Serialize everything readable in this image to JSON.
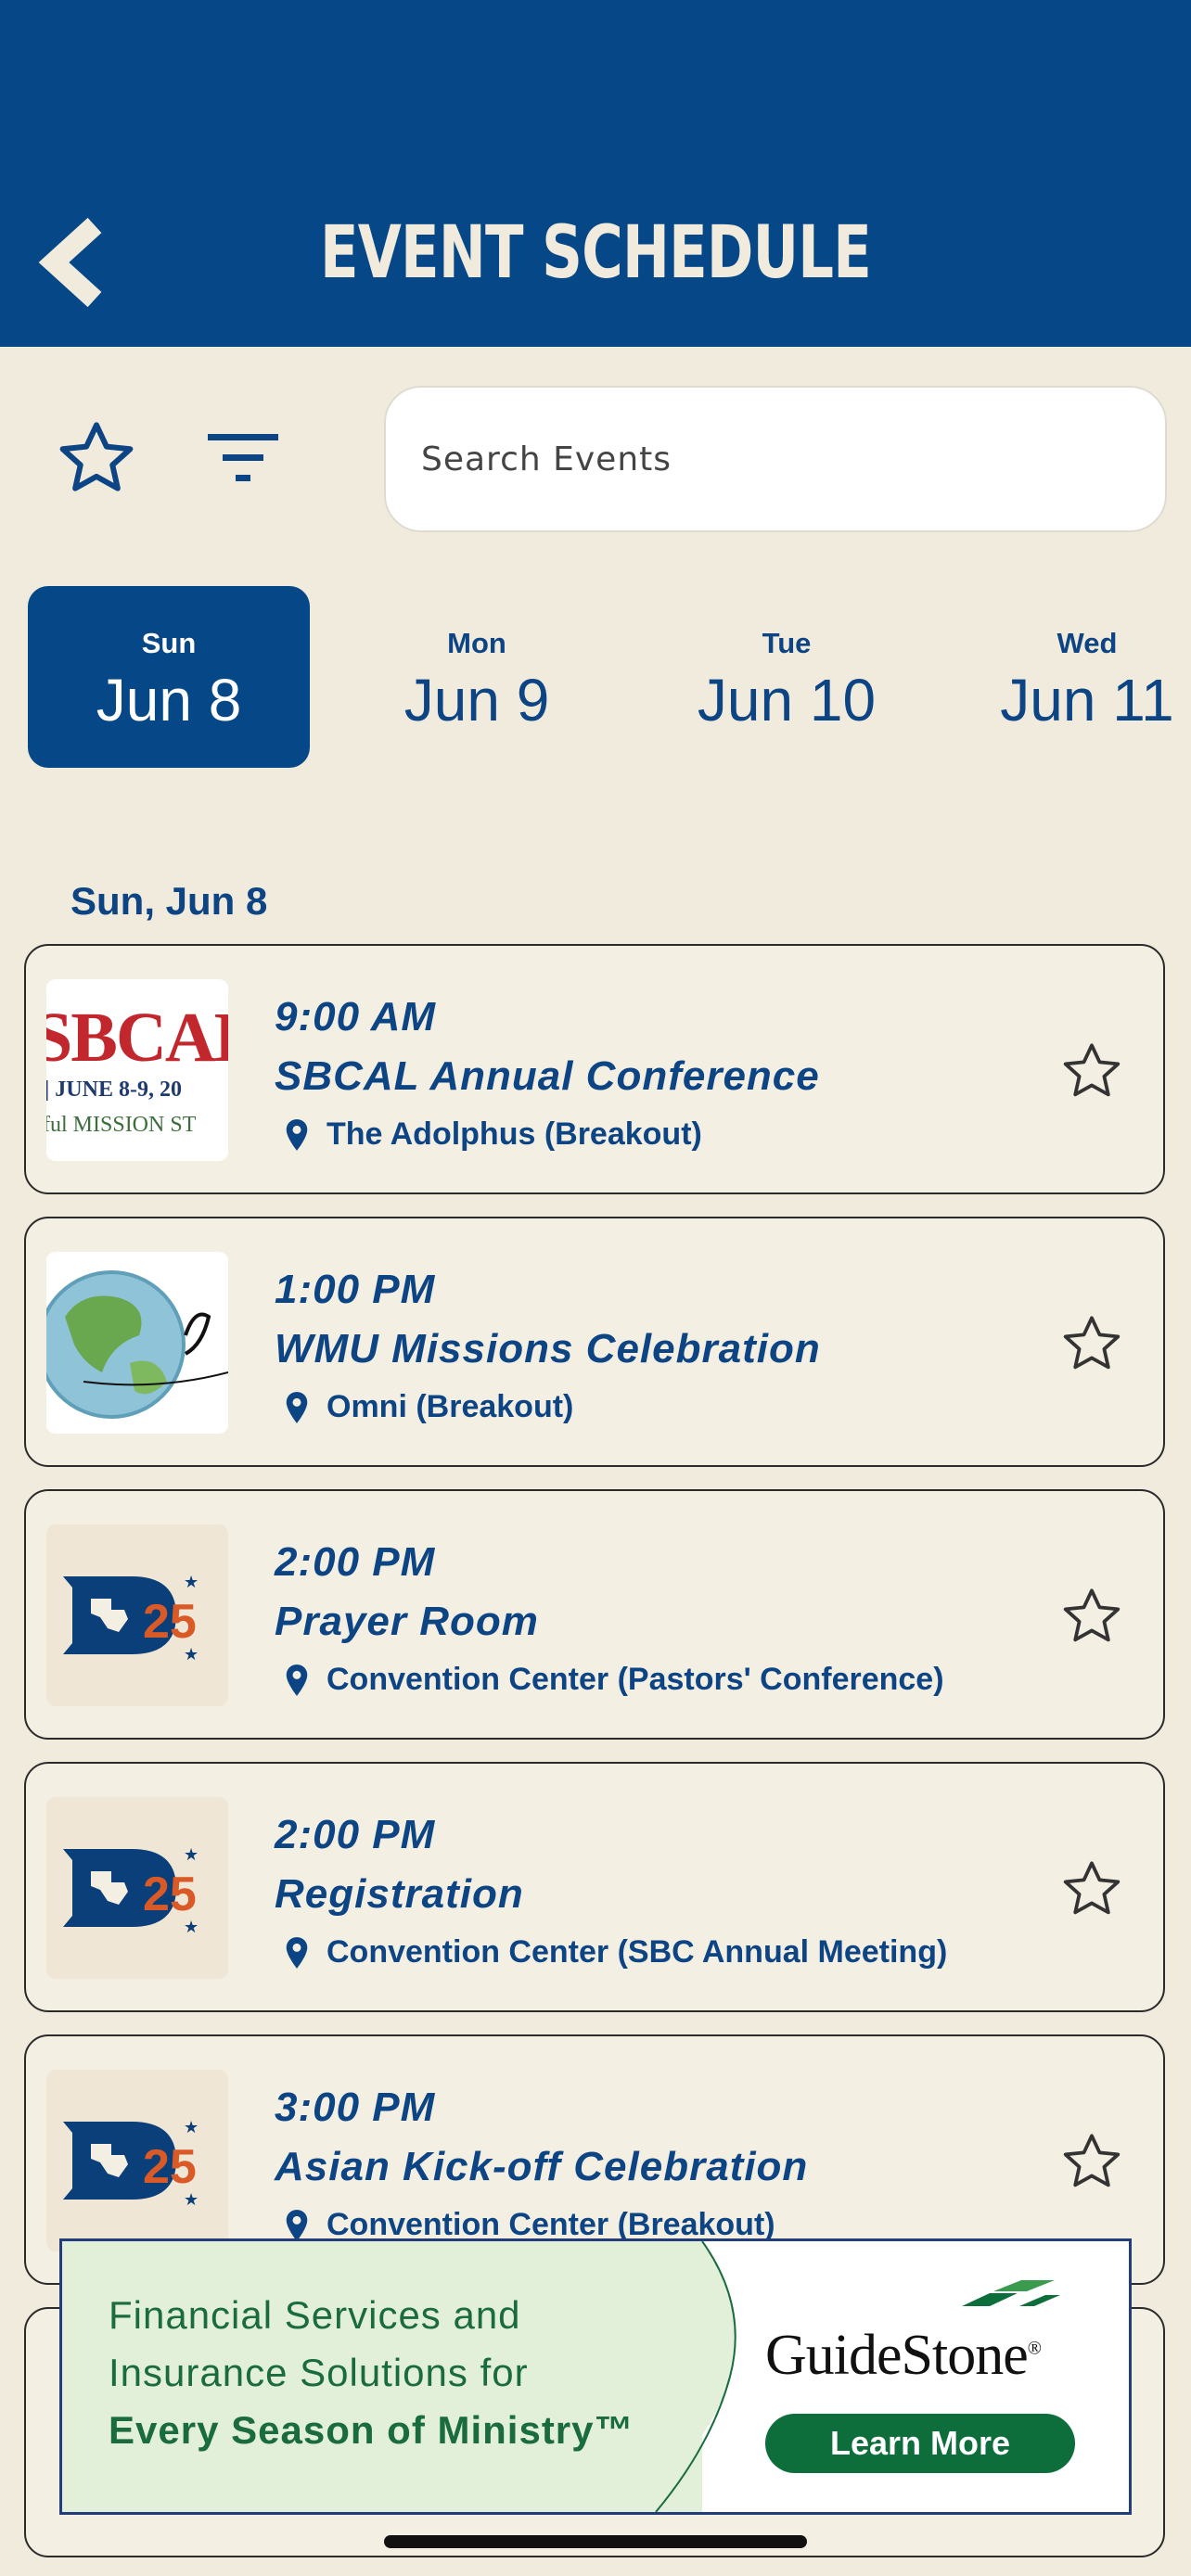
{
  "header": {
    "title": "EVENT SCHEDULE",
    "back_icon": "chevron-left-icon",
    "background": "#064887"
  },
  "toolbar": {
    "favorites_icon": "star-outline-icon",
    "filter_icon": "filter-icon",
    "search_placeholder": "Search Events"
  },
  "days": [
    {
      "dow": "Sun",
      "date": "Jun 8",
      "selected": true
    },
    {
      "dow": "Mon",
      "date": "Jun 9",
      "selected": false
    },
    {
      "dow": "Tue",
      "date": "Jun 10",
      "selected": false
    },
    {
      "dow": "Wed",
      "date": "Jun 11",
      "selected": false
    }
  ],
  "section": {
    "title": "Sun, Jun 8"
  },
  "events": [
    {
      "time": "9:00 AM",
      "title": "SBCAL Annual Conference",
      "location": "The Adolphus (Breakout)",
      "thumb": {
        "type": "sbcal",
        "big": "SBCAL",
        "sub": "| JUNE 8-9, 20",
        "tag": "ful  MISSION ST"
      }
    },
    {
      "time": "1:00 PM",
      "title": "WMU Missions Celebration",
      "location": "Omni (Breakout)",
      "thumb": {
        "type": "globe"
      }
    },
    {
      "time": "2:00 PM",
      "title": "Prayer Room",
      "location": "Convention Center (Pastors' Conference)",
      "thumb": {
        "type": "d25",
        "num": "25"
      }
    },
    {
      "time": "2:00 PM",
      "title": "Registration",
      "location": "Convention Center (SBC Annual Meeting)",
      "thumb": {
        "type": "d25",
        "num": "25"
      }
    },
    {
      "time": "3:00 PM",
      "title": "Asian Kick-off Celebration",
      "location": "Convention Center (Breakout)",
      "thumb": {
        "type": "d25",
        "num": "25"
      }
    }
  ],
  "ad": {
    "line1": "Financial Services and",
    "line2": "Insurance Solutions for",
    "line3": "Every Season of Ministry™",
    "brand": "GuideStone",
    "brand_mark": "®",
    "cta": "Learn More"
  }
}
